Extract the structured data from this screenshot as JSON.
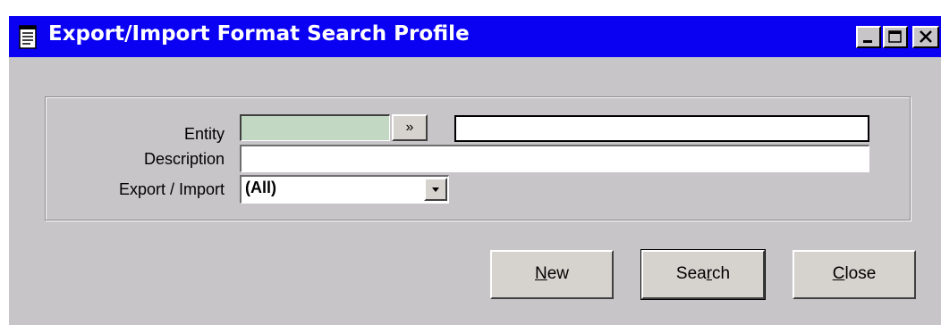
{
  "window": {
    "title": "Export/Import Format Search Profile",
    "title_bar_color": "#0a00f2",
    "icon": "document-icon",
    "controls": [
      "minimize-icon",
      "maximize-icon",
      "close-icon"
    ]
  },
  "form": {
    "entity": {
      "label": "Entity",
      "code_value": "",
      "lookup_label": "»",
      "name_value": ""
    },
    "description": {
      "label": "Description",
      "value": ""
    },
    "export_import": {
      "label": "Export / Import",
      "selected": "(All)"
    }
  },
  "buttons": {
    "new": {
      "pre": "",
      "mnemonic": "N",
      "post": "ew"
    },
    "search": {
      "pre": "Sea",
      "mnemonic": "r",
      "post": "ch"
    },
    "close": {
      "pre": "",
      "mnemonic": "C",
      "post": "lose"
    }
  }
}
